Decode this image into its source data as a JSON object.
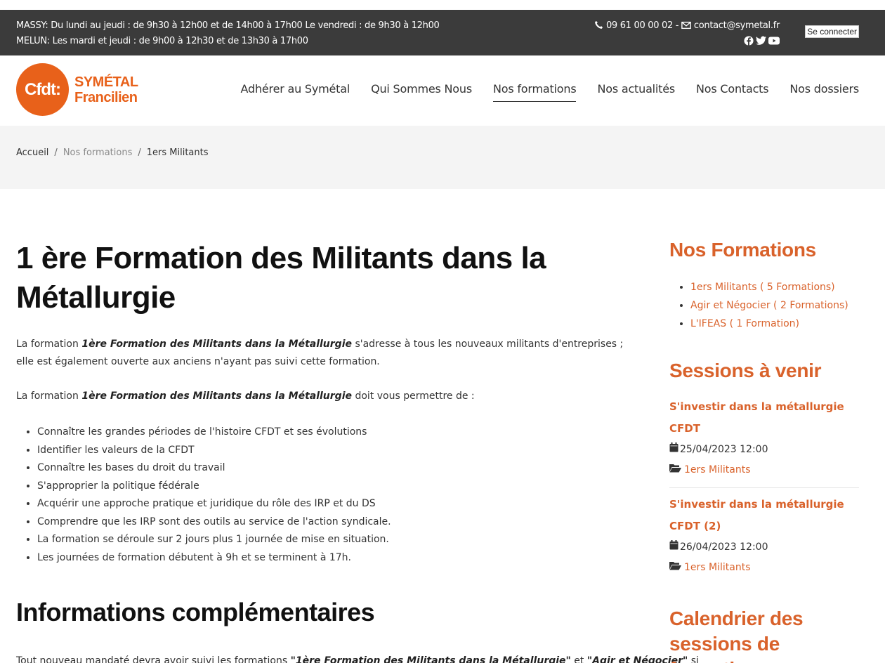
{
  "topbar": {
    "hours_line1": "MASSY: Du lundi au jeudi : de 9h30 à 12h00 et de 14h00 à 17h00 Le vendredi : de 9h30 à 12h00",
    "hours_line2": "MELUN: Les mardi et jeudi : de 9h00 à 12h30 et de 13h30 à 17h00",
    "phone": "09 61 00 00 02 -",
    "email": "contact@symetal.fr",
    "socials": [
      "facebook-icon",
      "twitter-icon",
      "youtube-icon"
    ],
    "login_label": "Se connecter"
  },
  "header": {
    "logo_mark": "Cfdt:",
    "logo_line1": "SYMÉTAL",
    "logo_line2": "Francilien",
    "nav": [
      {
        "label": "Adhérer au Symétal",
        "active": false
      },
      {
        "label": "Qui Sommes Nous",
        "active": false
      },
      {
        "label": "Nos formations",
        "active": true
      },
      {
        "label": "Nos actualités",
        "active": false
      },
      {
        "label": "Nos Contacts",
        "active": false
      },
      {
        "label": "Nos dossiers",
        "active": false
      }
    ]
  },
  "breadcrumb": {
    "items": [
      "Accueil",
      "Nos formations",
      "1ers Militants"
    ],
    "separator": "/"
  },
  "main": {
    "title": "1 ère Formation des Militants dans la Métallurgie",
    "intro_prefix": "La formation ",
    "intro_emph": "1ère Formation des Militants dans la Métallurgie",
    "intro_suffix": " s'adresse à tous les nouveaux militants d'entreprises ; elle est également ouverte aux anciens n'ayant pas suivi cette formation.",
    "goals_prefix": "La formation ",
    "goals_emph": "1ère Formation des Militants dans la Métallurgie",
    "goals_suffix": " doit vous permettre de :",
    "goals": [
      "Connaître les grandes périodes de l'histoire CFDT et ses évolutions",
      "Identifier les valeurs de la CFDT",
      "Connaître les bases du droit du travail",
      "S'approprier la politique fédérale",
      "Acquérir une approche pratique et juridique du rôle des IRP et du DS",
      "Comprendre que les IRP sont des outils au service de l'action syndicale.",
      "La formation se déroule sur 2 jours plus 1 journée de mise en situation.",
      "Les journées de formation débutent à 9h et se terminent à 17h."
    ],
    "info_title": "Informations complémentaires",
    "info_prefix": "Tout nouveau mandaté devra avoir suivi les formations ",
    "info_emph1": "\"1ère Formation des Militants dans la Métallurgie\"",
    "info_mid": " et ",
    "info_emph2": "\"Agir et Négocier\"",
    "info_suffix": " si"
  },
  "sidebar": {
    "formations_title": "Nos Formations",
    "formations": [
      "1ers Militants ( 5 Formations)",
      "Agir et Négocier ( 2 Formations)",
      "L'IFEAS ( 1 Formation)"
    ],
    "sessions_title": "Sessions à venir",
    "sessions": [
      {
        "title": "S'investir dans la métallurgie CFDT",
        "date": "25/04/2023 12:00",
        "category": "1ers Militants"
      },
      {
        "title": "S'investir dans la métallurgie CFDT (2)",
        "date": "26/04/2023 12:00",
        "category": "1ers Militants"
      }
    ],
    "calendar_title": "Calendrier des sessions de formation"
  },
  "colors": {
    "topbar_bg": "#3b3b3b",
    "accent": "#d9622b",
    "logo_orange": "#e8611a",
    "breadcrumb_bg": "#f4f4f4"
  }
}
